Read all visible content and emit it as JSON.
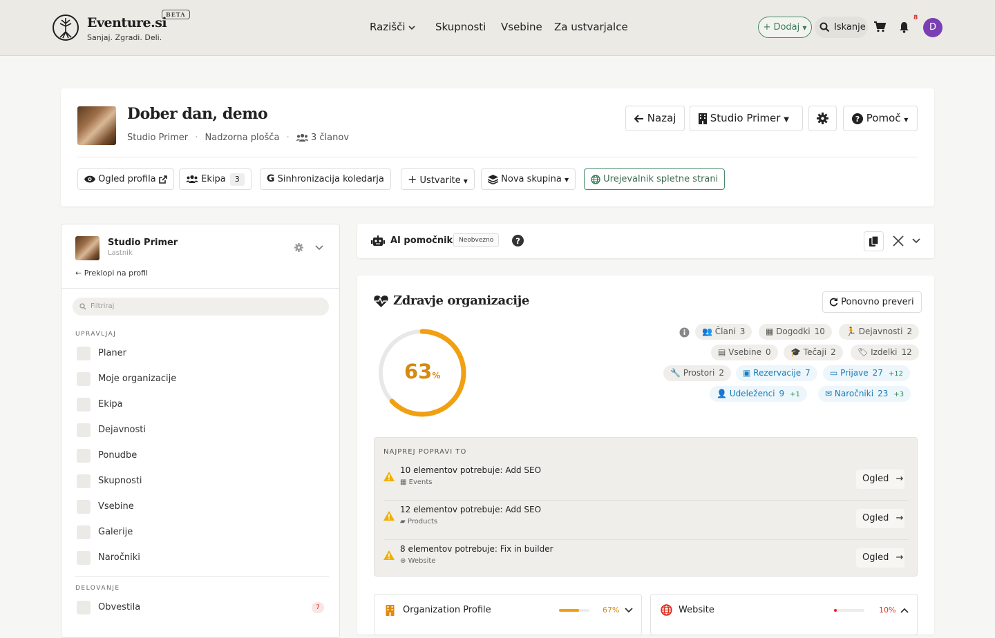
{
  "header": {
    "brand": "Eventure.si",
    "tagline": "Sanjaj. Zgradi. Deli.",
    "beta": "BETA",
    "nav": [
      "Razišči",
      "Skupnosti",
      "Vsebine",
      "Za ustvarjalce"
    ],
    "add_label": "+ Dodaj",
    "search_label": "Iskanje",
    "notification_count": "8",
    "avatar_initial": "D",
    "avatar_color": "#7b3fb4"
  },
  "page": {
    "title": "Dober dan, demo",
    "org": "Studio Primer",
    "section": "Nadzorna plošča",
    "members": "3 članov",
    "back": "Nazaj",
    "org_select": "Studio Primer",
    "help": "Pomoč",
    "toolbar": {
      "profile": "Ogled profila",
      "team": "Ekipa",
      "team_count": "3",
      "sync": "Sinhronizacija koledarja",
      "create": "Ustvarite",
      "group": "Nova skupina",
      "editor": "Urejevalnik spletne strani"
    }
  },
  "sidebar": {
    "org_name": "Studio Primer",
    "role": "Lastnik",
    "switch": "Preklopi na profil",
    "filter_placeholder": "Filtriraj",
    "manage_label": "UPRAVLJAJ",
    "manage_items": [
      "Planer",
      "Moje organizacije",
      "Ekipa",
      "Dejavnosti",
      "Ponudbe",
      "Skupnosti",
      "Vsebine",
      "Galerije",
      "Naročniki"
    ],
    "ops_label": "DELOVANJE",
    "ops_items": [
      "Obvestila"
    ],
    "ops_badge": "7"
  },
  "ai": {
    "title": "AI pomočnik",
    "badge": "Neobvezno"
  },
  "health": {
    "title": "Zdravje organizacije",
    "recheck": "Ponovno preveri",
    "score": 63,
    "score_text": "63",
    "score_unit": "%",
    "accent": "#f0a010",
    "chips_row1": [
      {
        "label": "Člani",
        "value": "3"
      },
      {
        "label": "Dogodki",
        "value": "10"
      },
      {
        "label": "Dejavnosti",
        "value": "2"
      }
    ],
    "chips_row2": [
      {
        "label": "Vsebine",
        "value": "0"
      },
      {
        "label": "Tečaji",
        "value": "2"
      },
      {
        "label": "Izdelki",
        "value": "12"
      }
    ],
    "chips_row3": [
      {
        "label": "Prostori",
        "value": "2"
      },
      {
        "label": "Rezervacije",
        "value": "7"
      },
      {
        "label": "Prijave",
        "value": "27",
        "plus": "+12"
      }
    ],
    "chips_row4": [
      {
        "label": "Udeleženci",
        "value": "9",
        "plus": "+1"
      },
      {
        "label": "Naročniki",
        "value": "23",
        "plus": "+3"
      }
    ],
    "fix_label": "NAJPREJ POPRAVI TO",
    "fixes": [
      {
        "title": "10 elementov potrebuje: Add SEO",
        "category": "Events",
        "action": "Ogled"
      },
      {
        "title": "12 elementov potrebuje: Add SEO",
        "category": "Products",
        "action": "Ogled"
      },
      {
        "title": "8 elementov potrebuje: Fix in builder",
        "category": "Website",
        "action": "Ogled"
      }
    ],
    "cards": [
      {
        "title": "Organization Profile",
        "percent": "67%",
        "value": 0.67,
        "color": "#f0a010"
      },
      {
        "title": "Website",
        "percent": "10%",
        "value": 0.1,
        "color": "#e02424"
      }
    ]
  }
}
